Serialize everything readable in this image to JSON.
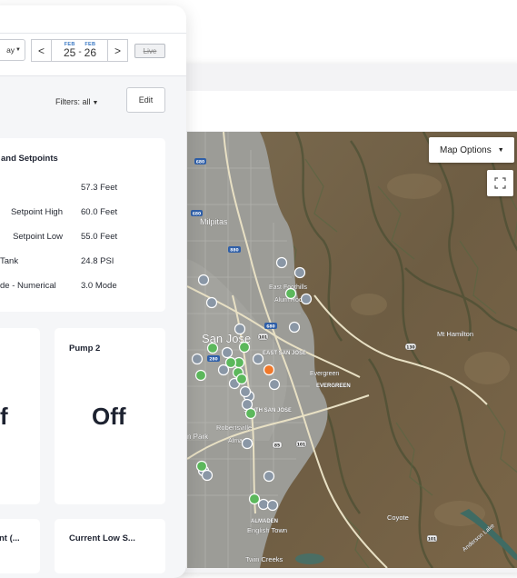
{
  "header": {
    "range_label": "ay",
    "date_range": {
      "start_month": "FEB",
      "start_day": "25",
      "end_month": "FEB",
      "end_day": "26",
      "separator": "-"
    },
    "prev_icon": "chevron-left-icon",
    "next_icon": "chevron-right-icon",
    "live_label": "Live"
  },
  "toolbar": {
    "filters_label": "Filters: all",
    "edit_label": "Edit"
  },
  "setpoints_card": {
    "title": "and Setpoints",
    "rows": [
      {
        "label": "",
        "value": "57.3 Feet"
      },
      {
        "label": "Setpoint High",
        "value": "60.0 Feet"
      },
      {
        "label": "Setpoint Low",
        "value": "55.0 Feet"
      },
      {
        "label": "Tank",
        "value": "24.8 PSI"
      },
      {
        "label": "de - Numerical",
        "value": "3.0 Mode"
      }
    ]
  },
  "pumps": [
    {
      "title": "",
      "state": "f"
    },
    {
      "title": "Pump 2",
      "state": "Off"
    }
  ],
  "bottom_cards": [
    {
      "title": "nt (..."
    },
    {
      "title": "Current Low S..."
    }
  ],
  "map": {
    "options_label": "Map Options",
    "fullscreen_icon": "fullscreen-icon",
    "place_labels": [
      "Milpitas",
      "East Foothills",
      "Alum Rock",
      "San Jose",
      "EAST SAN JOSE",
      "Evergreen",
      "EVERGREEN",
      "SOUTH SAN JOSE",
      "Robertsville",
      "Almaden",
      "ALMADEN",
      "English Town",
      "Coyote",
      "Mt Hamilton",
      "Twin Creeks",
      "Anderson Lake",
      "n Park"
    ],
    "road_labels": [
      "680",
      "680",
      "880",
      "680",
      "101",
      "280",
      "130",
      "85",
      "101",
      "101"
    ],
    "colors": {
      "online": "#5cb85c",
      "offline": "#8a97a6",
      "alert": "#f0782a"
    },
    "markers": [
      {
        "status": "offline"
      },
      {
        "status": "offline"
      },
      {
        "status": "offline"
      },
      {
        "status": "online"
      },
      {
        "status": "offline"
      },
      {
        "status": "offline"
      },
      {
        "status": "offline"
      },
      {
        "status": "online"
      },
      {
        "status": "online"
      },
      {
        "status": "offline"
      },
      {
        "status": "offline"
      },
      {
        "status": "online"
      },
      {
        "status": "offline"
      },
      {
        "status": "online"
      },
      {
        "status": "online"
      },
      {
        "status": "alert"
      },
      {
        "status": "offline"
      },
      {
        "status": "offline"
      },
      {
        "status": "offline"
      },
      {
        "status": "offline"
      },
      {
        "status": "offline"
      },
      {
        "status": "offline"
      },
      {
        "status": "offline"
      },
      {
        "status": "offline"
      },
      {
        "status": "online"
      },
      {
        "status": "online"
      },
      {
        "status": "offline"
      },
      {
        "status": "offline"
      },
      {
        "status": "online"
      },
      {
        "status": "offline"
      },
      {
        "status": "offline"
      },
      {
        "status": "online"
      },
      {
        "status": "online"
      },
      {
        "status": "offline"
      }
    ]
  }
}
